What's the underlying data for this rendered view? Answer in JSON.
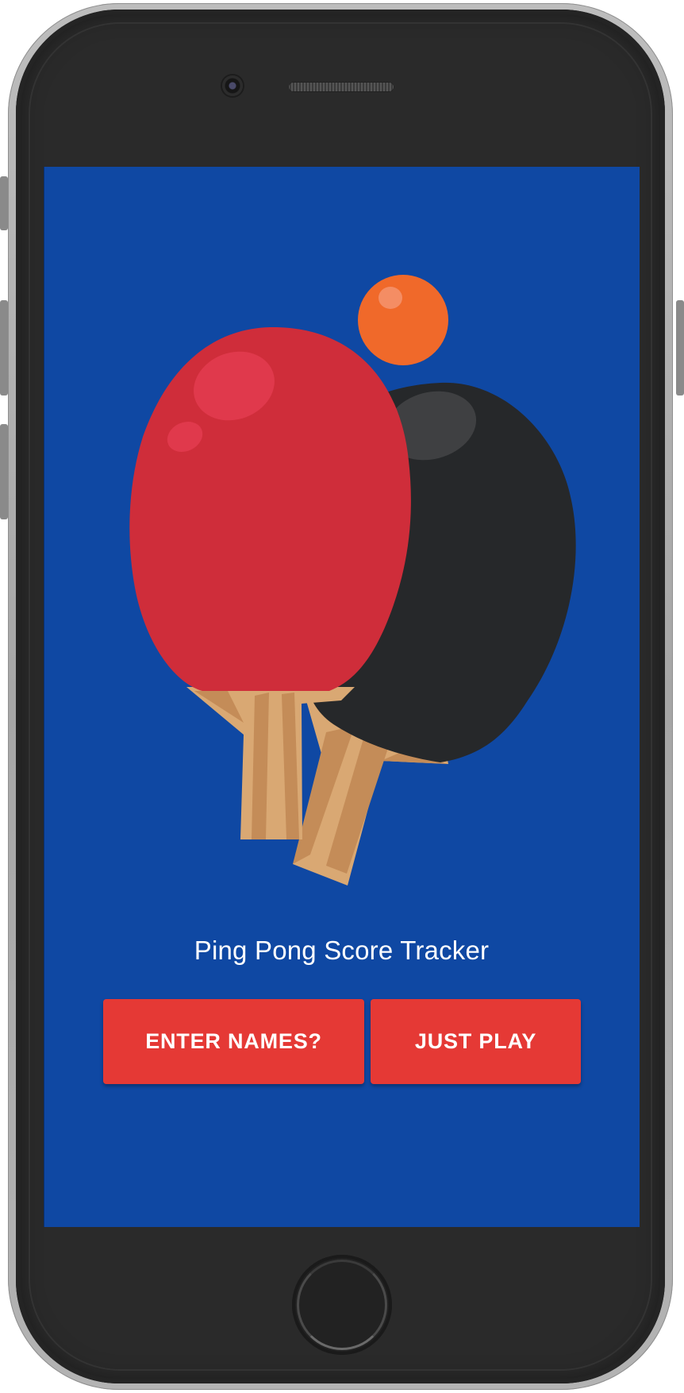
{
  "app": {
    "title": "Ping Pong Score Tracker"
  },
  "actions": {
    "enter_names_label": "ENTER NAMES?",
    "just_play_label": "JUST PLAY"
  },
  "colors": {
    "screen_background": "#0f48a3",
    "button_background": "#e53935",
    "button_text": "#ffffff",
    "red_paddle": "#cf2d3a",
    "black_paddle": "#26282a",
    "ball": "#f0692a",
    "handle_dark": "#c48c58",
    "handle_light": "#d9a873"
  },
  "icons": {
    "hero": "ping-pong-paddles-and-ball-illustration"
  }
}
